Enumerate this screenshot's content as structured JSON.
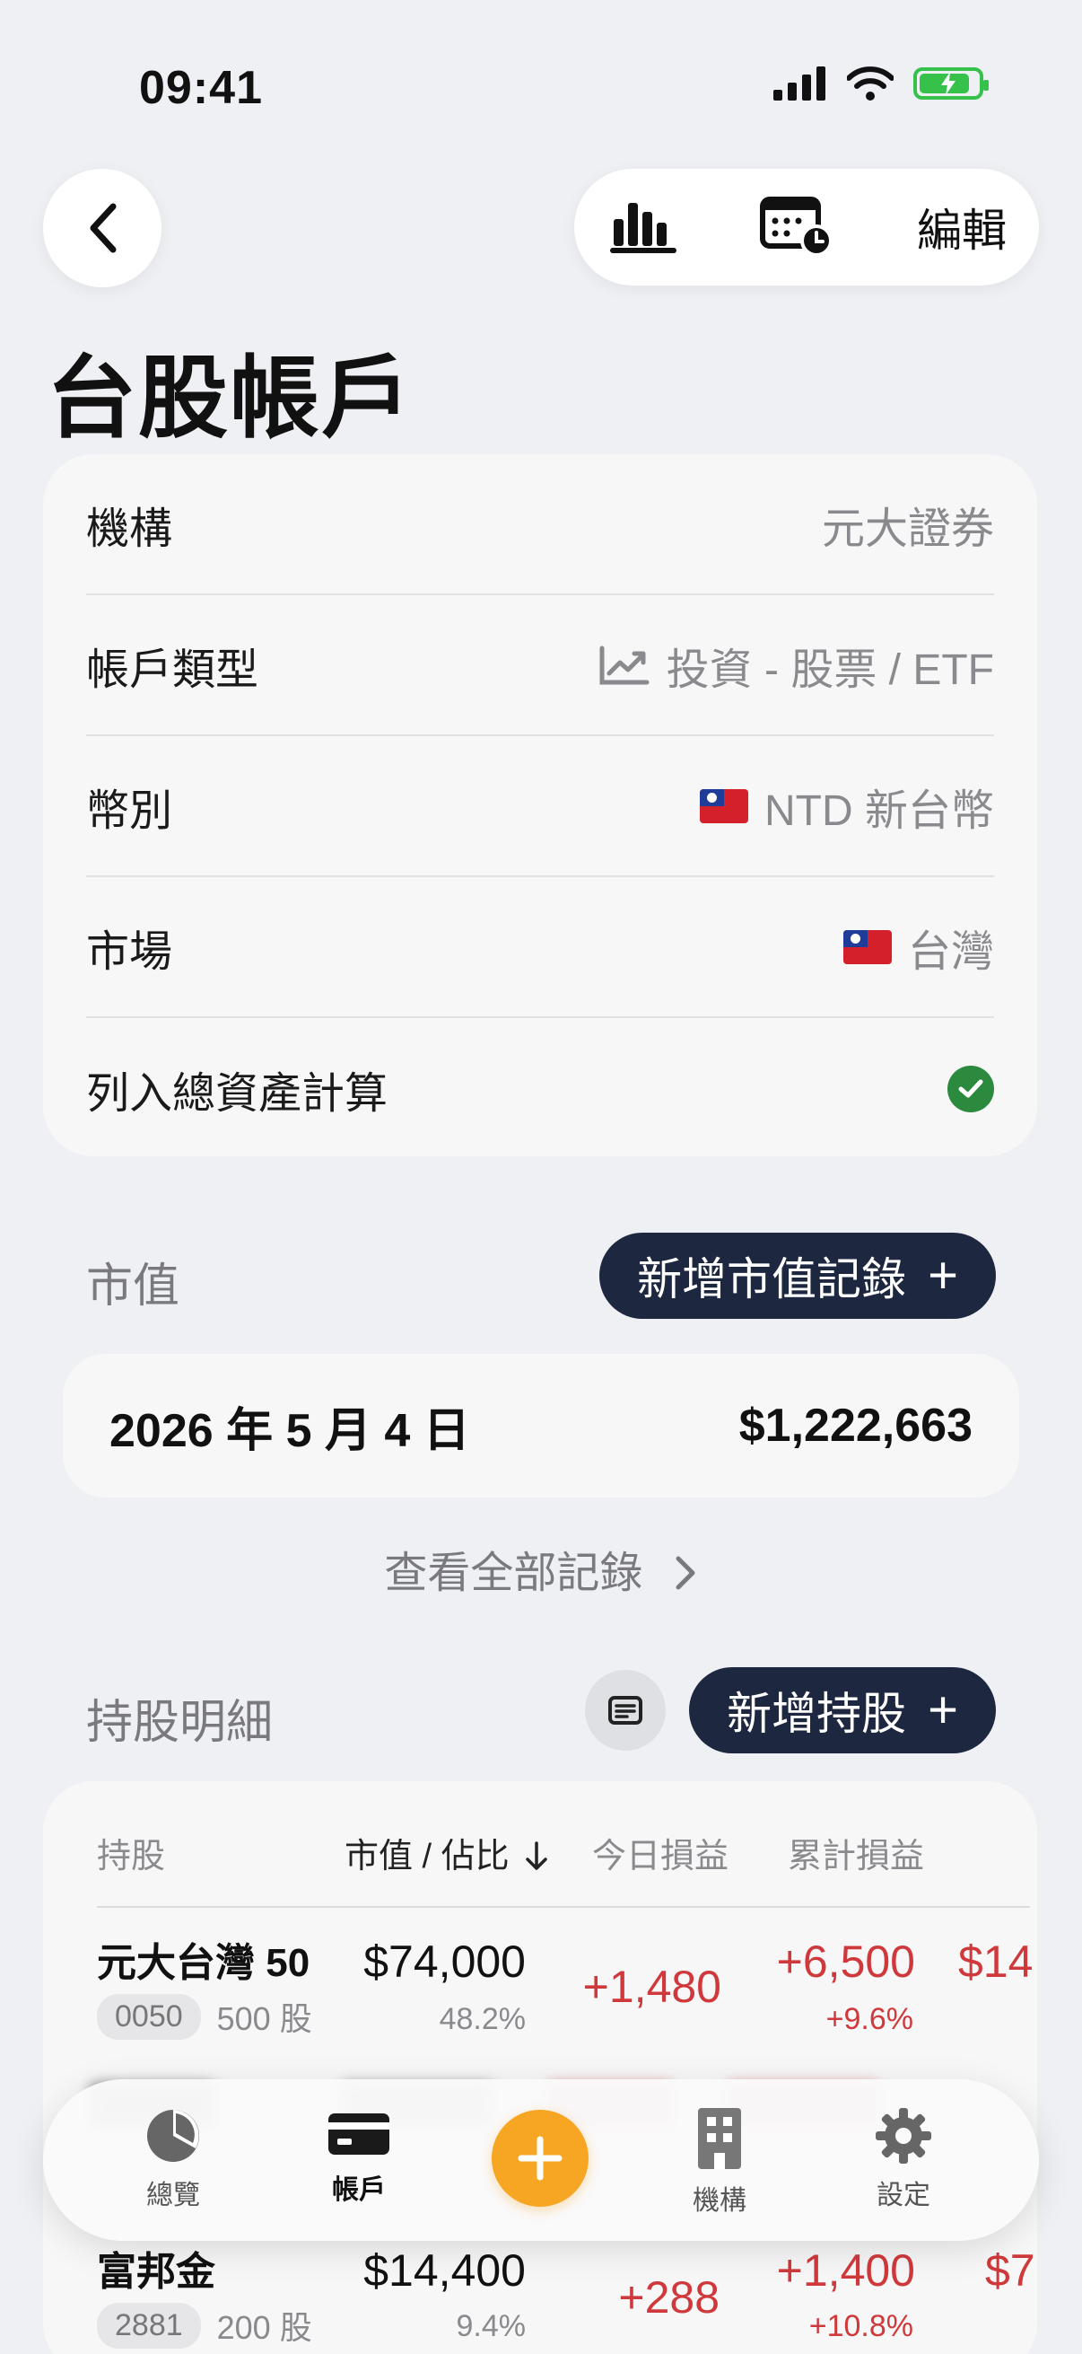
{
  "status_bar": {
    "time": "09:41"
  },
  "nav": {
    "edit_label": "編輯"
  },
  "page": {
    "title": "台股帳戶"
  },
  "account_info": {
    "institution_label": "機構",
    "institution_value": "元大證券",
    "type_label": "帳戶類型",
    "type_value": "投資 - 股票 / ETF",
    "currency_label": "幣別",
    "currency_value": "NTD 新台幣",
    "market_label": "市場",
    "market_value": "台灣",
    "include_label": "列入總資產計算",
    "include_checked": true
  },
  "market_value": {
    "section_label": "市值",
    "add_button_label": "新增市值記錄",
    "latest_date": "2026 年 5 月 4 日",
    "latest_amount": "$1,222,663",
    "see_all_label": "查看全部記錄"
  },
  "holdings": {
    "section_label": "持股明細",
    "add_button_label": "新增持股",
    "columns": {
      "holding": "持股",
      "value_share": "市值 / 佔比",
      "today_pl": "今日損益",
      "total_pl": "累計損益"
    },
    "rows": [
      {
        "name": "元大台灣 50",
        "code": "0050",
        "shares": "500 股",
        "value": "$74,000",
        "share_pct": "48.2%",
        "today_pl": "+1,480",
        "total_pl": "+6,500",
        "total_pl_pct": "+9.6%",
        "next_col_partial": "$14"
      },
      {
        "name": "富邦金",
        "code": "2881",
        "shares": "200 股",
        "value": "$14,400",
        "share_pct": "9.4%",
        "today_pl": "+288",
        "total_pl": "+1,400",
        "total_pl_pct": "+10.8%",
        "next_col_partial": "$7"
      }
    ]
  },
  "tabbar": {
    "overview_label": "總覽",
    "accounts_label": "帳戶",
    "institutions_label": "機構",
    "settings_label": "設定"
  },
  "colors": {
    "accent_dark": "#1d2740",
    "fab_orange": "#f6a623",
    "gain_red": "#d0393b",
    "check_green": "#2b8a3e"
  }
}
